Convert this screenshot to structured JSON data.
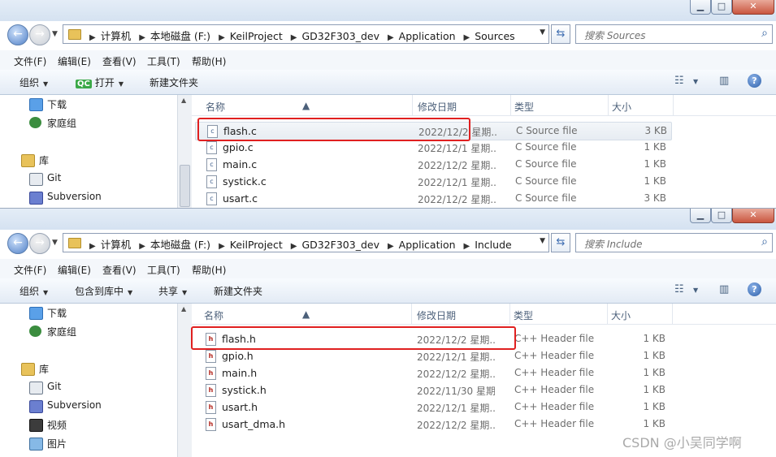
{
  "windows": [
    {
      "window_controls": {
        "minimize": "▁",
        "maximize": "□",
        "close": "✕"
      },
      "breadcrumbs": [
        "计算机",
        "本地磁盘 (F:)",
        "KeilProject",
        "GD32F303_dev",
        "Application",
        "Sources"
      ],
      "search_placeholder": "搜索 Sources",
      "menu": [
        "文件(F)",
        "编辑(E)",
        "查看(V)",
        "工具(T)",
        "帮助(H)"
      ],
      "toolbar": {
        "organize": "组织",
        "open": "打开",
        "new_folder": "新建文件夹"
      },
      "nav": [
        {
          "label": "下载",
          "icon": "download-folder-icon"
        },
        {
          "label": "家庭组",
          "icon": "homegroup-icon"
        },
        {
          "label": "库",
          "icon": "library-icon"
        },
        {
          "label": "Git",
          "icon": "git-icon"
        },
        {
          "label": "Subversion",
          "icon": "subversion-icon"
        }
      ],
      "columns": {
        "name": "名称",
        "date": "修改日期",
        "type": "类型",
        "size": "大小"
      },
      "files": [
        {
          "name": "flash.c",
          "date": "2022/12/2 星期...",
          "type": "C Source file",
          "size": "3 KB",
          "icon": "c-file-icon"
        },
        {
          "name": "gpio.c",
          "date": "2022/12/1 星期...",
          "type": "C Source file",
          "size": "1 KB",
          "icon": "c-file-icon"
        },
        {
          "name": "main.c",
          "date": "2022/12/2 星期...",
          "type": "C Source file",
          "size": "1 KB",
          "icon": "c-file-icon"
        },
        {
          "name": "systick.c",
          "date": "2022/12/1 星期...",
          "type": "C Source file",
          "size": "1 KB",
          "icon": "c-file-icon"
        },
        {
          "name": "usart.c",
          "date": "2022/12/2 星期...",
          "type": "C Source file",
          "size": "3 KB",
          "icon": "c-file-icon"
        }
      ],
      "highlighted_file": "flash.c"
    },
    {
      "window_controls": {
        "minimize": "▁",
        "maximize": "□",
        "close": "✕"
      },
      "breadcrumbs": [
        "计算机",
        "本地磁盘 (F:)",
        "KeilProject",
        "GD32F303_dev",
        "Application",
        "Include"
      ],
      "search_placeholder": "搜索 Include",
      "menu": [
        "文件(F)",
        "编辑(E)",
        "查看(V)",
        "工具(T)",
        "帮助(H)"
      ],
      "toolbar": {
        "organize": "组织",
        "include_in_library": "包含到库中",
        "share": "共享",
        "new_folder": "新建文件夹"
      },
      "nav": [
        {
          "label": "下载",
          "icon": "download-folder-icon"
        },
        {
          "label": "家庭组",
          "icon": "homegroup-icon"
        },
        {
          "label": "库",
          "icon": "library-icon"
        },
        {
          "label": "Git",
          "icon": "git-icon"
        },
        {
          "label": "Subversion",
          "icon": "subversion-icon"
        },
        {
          "label": "视频",
          "icon": "video-library-icon"
        },
        {
          "label": "图片",
          "icon": "picture-library-icon"
        }
      ],
      "columns": {
        "name": "名称",
        "date": "修改日期",
        "type": "类型",
        "size": "大小"
      },
      "files": [
        {
          "name": "flash.h",
          "date": "2022/12/2 星期...",
          "type": "C++ Header file",
          "size": "1 KB",
          "icon": "h-file-icon"
        },
        {
          "name": "gpio.h",
          "date": "2022/12/1 星期...",
          "type": "C++ Header file",
          "size": "1 KB",
          "icon": "h-file-icon"
        },
        {
          "name": "main.h",
          "date": "2022/12/2 星期...",
          "type": "C++ Header file",
          "size": "1 KB",
          "icon": "h-file-icon"
        },
        {
          "name": "systick.h",
          "date": "2022/11/30 星期...",
          "type": "C++ Header file",
          "size": "1 KB",
          "icon": "h-file-icon"
        },
        {
          "name": "usart.h",
          "date": "2022/12/1 星期...",
          "type": "C++ Header file",
          "size": "1 KB",
          "icon": "h-file-icon"
        },
        {
          "name": "usart_dma.h",
          "date": "2022/12/2 星期...",
          "type": "C++ Header file",
          "size": "1 KB",
          "icon": "h-file-icon"
        }
      ],
      "highlighted_file": "flash.h"
    }
  ],
  "watermark": "CSDN @小吴同学啊",
  "colors": {
    "highlight_box": "#e02020",
    "accent": "#3e6db1"
  }
}
